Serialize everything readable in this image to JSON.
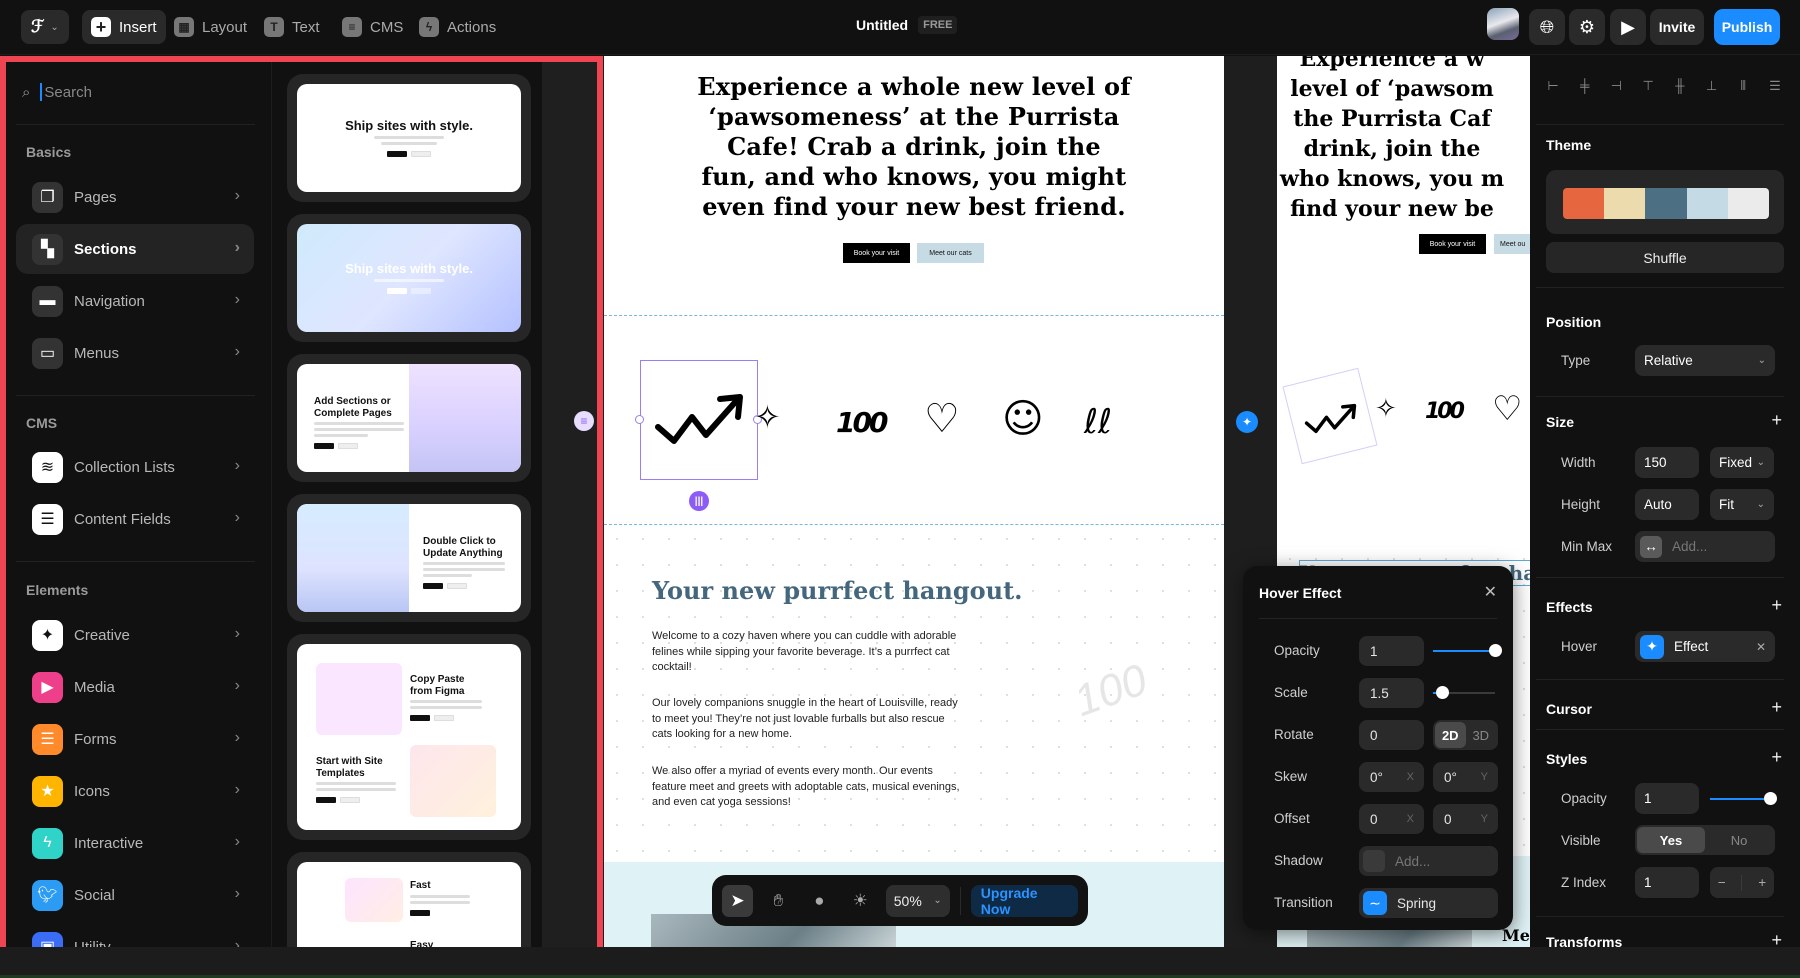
{
  "topbar": {
    "logo": "framer-logo",
    "tools": [
      {
        "label": "Insert",
        "icon": "plus-icon",
        "active": true
      },
      {
        "label": "Layout",
        "icon": "layout-icon",
        "active": false
      },
      {
        "label": "Text",
        "icon": "text-icon",
        "active": false
      },
      {
        "label": "CMS",
        "icon": "database-icon",
        "active": false
      },
      {
        "label": "Actions",
        "icon": "bolt-icon",
        "active": false
      }
    ],
    "title": "Untitled",
    "plan_badge": "FREE",
    "invite_label": "Invite",
    "publish_label": "Publish",
    "publish_color": "#1a8cff"
  },
  "insert_panel": {
    "search_placeholder": "Search",
    "sections": [
      {
        "label": "Basics",
        "items": [
          {
            "label": "Pages",
            "icon": "pages-icon",
            "color": "#333333"
          },
          {
            "label": "Sections",
            "icon": "sections-icon",
            "color": "#333333",
            "selected": true
          },
          {
            "label": "Navigation",
            "icon": "navigation-icon",
            "color": "#333333"
          },
          {
            "label": "Menus",
            "icon": "menus-icon",
            "color": "#333333"
          }
        ]
      },
      {
        "label": "CMS",
        "items": [
          {
            "label": "Collection Lists",
            "icon": "database-icon",
            "color": "#ffffff"
          },
          {
            "label": "Content Fields",
            "icon": "text-lines-icon",
            "color": "#ffffff"
          }
        ]
      },
      {
        "label": "Elements",
        "items": [
          {
            "label": "Creative",
            "icon": "sparkle-icon",
            "color": "#ffffff"
          },
          {
            "label": "Media",
            "icon": "play-icon",
            "color": "#ee3f8b"
          },
          {
            "label": "Forms",
            "icon": "forms-icon",
            "color": "#ff8a2b"
          },
          {
            "label": "Icons",
            "icon": "star-icon",
            "color": "#ffb400"
          },
          {
            "label": "Interactive",
            "icon": "bolt-icon",
            "color": "#2fd3c8"
          },
          {
            "label": "Social",
            "icon": "twitter-icon",
            "color": "#2b9bf4"
          },
          {
            "label": "Utility",
            "icon": "utility-icon",
            "color": "#3b6cf6"
          }
        ]
      }
    ],
    "thumbnails": [
      {
        "title": "Ship sites with style.",
        "style": "white-centered"
      },
      {
        "title": "Ship sites with style.",
        "style": "gradient-centered"
      },
      {
        "title": "Add Sections or Complete Pages",
        "style": "split-left-text"
      },
      {
        "title": "Double Click to Update Anything",
        "style": "split-right-text"
      },
      {
        "title": "Copy Paste from Figma",
        "title2": "Start with Site Templates",
        "style": "zigzag"
      },
      {
        "title": "Fast",
        "title2": "Easy",
        "style": "feature-list"
      }
    ]
  },
  "canvas": {
    "hero_text": "Experience a whole new level of ‘pawsomeness’ at the Purrista Cafe! Crab a drink, join the fun, and who knows, you might even find your new best friend.",
    "hero_lines": [
      "Experience a whole new level of",
      "‘pawsomeness’ at the Purrista",
      "Cafe! Crab a drink, join the",
      "fun, and who knows, you might",
      "even find your new best friend."
    ],
    "hero_lines_frame2": [
      "Experience a w",
      "level of ‘pawsom",
      "the Purrista Caf",
      "drink, join the",
      "who knows, you m",
      "find your new be"
    ],
    "cta_primary": "Book your visit",
    "cta_secondary": "Meet our cats",
    "cta_secondary_short": "Meet ou",
    "stickers": [
      "trend-arrow-sticker",
      "sparkles-sticker",
      "hundred-sticker",
      "heart-sticker",
      "smiley-sticker",
      "squiggle-sticker"
    ],
    "sticker_glyphs": [
      "↗",
      "✧",
      "100",
      "♡",
      "☺",
      "ℓℓ"
    ],
    "section_heading": "Your new purrfect hangout.",
    "section_heading_frame2": "Your new purrfect ha",
    "paragraphs": [
      "Welcome to a cozy haven where you can cuddle with adorable felines while sipping your favorite beverage. It’s a purrfect cat cocktail!",
      "Our lovely companions snuggle in the heart of Louisville, ready to meet you! They’re not just lovable furballs but also rescue cats looking for a new home.",
      "We also offer a myriad of events every month. Our events feature meet and greets with adoptable cats, musical evenings, and even cat yoga sessions!"
    ],
    "frame2_footer_text": "Me"
  },
  "hover_effect": {
    "title": "Hover Effect",
    "opacity": {
      "label": "Opacity",
      "value": "1",
      "slider_fraction": 1.0
    },
    "scale": {
      "label": "Scale",
      "value": "1.5",
      "slider_fraction": 0.15
    },
    "rotate": {
      "label": "Rotate",
      "value": "0",
      "modes": [
        "2D",
        "3D"
      ],
      "active_mode": "2D"
    },
    "skew": {
      "label": "Skew",
      "x": "0°",
      "y": "0°",
      "x_axis": "X",
      "y_axis": "Y"
    },
    "offset": {
      "label": "Offset",
      "x": "0",
      "y": "0",
      "x_axis": "X",
      "y_axis": "Y"
    },
    "shadow": {
      "label": "Shadow",
      "placeholder": "Add..."
    },
    "transition": {
      "label": "Transition",
      "value": "Spring"
    }
  },
  "right_panel": {
    "theme": {
      "label": "Theme",
      "colors": [
        "#e5663f",
        "#ecdcad",
        "#4d6f84",
        "#c4dbe6",
        "#ebebeb"
      ],
      "shuffle_label": "Shuffle"
    },
    "position": {
      "label": "Position",
      "type_label": "Type",
      "type_value": "Relative"
    },
    "size": {
      "label": "Size",
      "width_label": "Width",
      "width_value": "150",
      "width_mode": "Fixed",
      "height_label": "Height",
      "height_value": "Auto",
      "height_mode": "Fit",
      "minmax_label": "Min Max",
      "minmax_placeholder": "Add..."
    },
    "effects": {
      "label": "Effects",
      "hover_label": "Hover",
      "hover_value": "Effect"
    },
    "cursor": {
      "label": "Cursor"
    },
    "styles": {
      "label": "Styles",
      "opacity_label": "Opacity",
      "opacity_value": "1",
      "opacity_fraction": 1.0,
      "visible_label": "Visible",
      "visible_options": [
        "Yes",
        "No"
      ],
      "visible_value": "Yes",
      "zindex_label": "Z Index",
      "zindex_value": "1"
    },
    "transforms": {
      "label": "Transforms"
    }
  },
  "toolbar": {
    "tools": [
      "select-tool",
      "hand-tool",
      "comment-tool",
      "theme-toggle"
    ],
    "zoom": "50%",
    "upgrade_label": "Upgrade Now"
  }
}
